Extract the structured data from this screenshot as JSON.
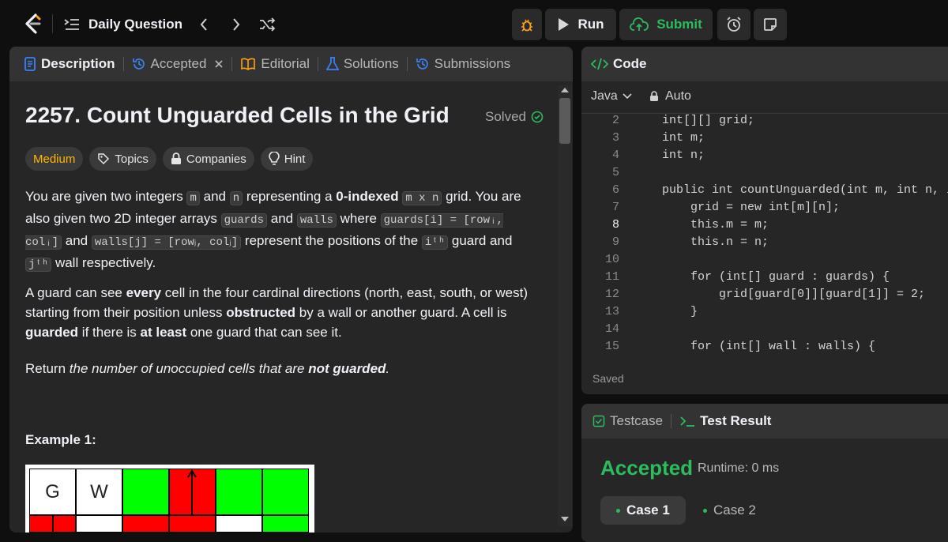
{
  "header": {
    "title": "Daily Question",
    "run_label": "Run",
    "submit_label": "Submit"
  },
  "left_tabs": {
    "description": "Description",
    "accepted": "Accepted",
    "editorial": "Editorial",
    "solutions": "Solutions",
    "submissions": "Submissions"
  },
  "problem": {
    "title": "2257. Count Unguarded Cells in the Grid",
    "status": "Solved",
    "difficulty": "Medium",
    "chips": [
      "Topics",
      "Companies",
      "Hint"
    ],
    "p1": {
      "a": "You are given two integers",
      "m": "m",
      "b": "and",
      "n": "n",
      "c": "representing a",
      "bold": "0-indexed",
      "mxn": "m x n",
      "d": "grid. You are also given two 2D integer arrays",
      "guards": "guards",
      "e": "and",
      "walls": "walls",
      "f": "where",
      "guards_i": "guards[i] = [rowᵢ, colᵢ]",
      "g": "and",
      "walls_j": "walls[j] = [rowⱼ, colⱼ]",
      "h": "represent the positions of the",
      "ith": "iᵗʰ",
      "i": "guard and",
      "jth": "jᵗʰ",
      "j": "wall respectively."
    },
    "p2": {
      "a": "A guard can see",
      "every": "every",
      "b": "cell in the four cardinal directions (north, east, south, or west) starting from their position unless",
      "obstructed": "obstructed",
      "c": "by a wall or another guard. A cell is",
      "guarded": "guarded",
      "d": "if there is",
      "at_least": "at least",
      "e": "one guard that can see it."
    },
    "p3": {
      "a": "Return",
      "b": "the number of unoccupied cells that are",
      "not_guarded": "not guarded",
      "c": "."
    },
    "example_title": "Example 1:",
    "example_cells": [
      "G",
      "W"
    ]
  },
  "code_panel": {
    "title": "Code",
    "language": "Java",
    "mode": "Auto",
    "saved": "Saved",
    "lines": [
      {
        "n": "2",
        "text": "    int[][] grid;"
      },
      {
        "n": "3",
        "text": "    int m;"
      },
      {
        "n": "4",
        "text": "    int n;"
      },
      {
        "n": "5",
        "text": ""
      },
      {
        "n": "6",
        "text": "    public int countUnguarded(int m, int n, in"
      },
      {
        "n": "7",
        "text": "        grid = new int[m][n];"
      },
      {
        "n": "8",
        "text": "        this.m = m;"
      },
      {
        "n": "9",
        "text": "        this.n = n;"
      },
      {
        "n": "10",
        "text": ""
      },
      {
        "n": "11",
        "text": "        for (int[] guard : guards) {"
      },
      {
        "n": "12",
        "text": "            grid[guard[0]][guard[1]] = 2;"
      },
      {
        "n": "13",
        "text": "        }"
      },
      {
        "n": "14",
        "text": ""
      },
      {
        "n": "15",
        "text": "        for (int[] wall : walls) {"
      }
    ]
  },
  "test_panel": {
    "tab_testcase": "Testcase",
    "tab_result": "Test Result",
    "verdict": "Accepted",
    "runtime": "Runtime: 0 ms",
    "case1": "Case 1",
    "case2": "Case 2"
  }
}
